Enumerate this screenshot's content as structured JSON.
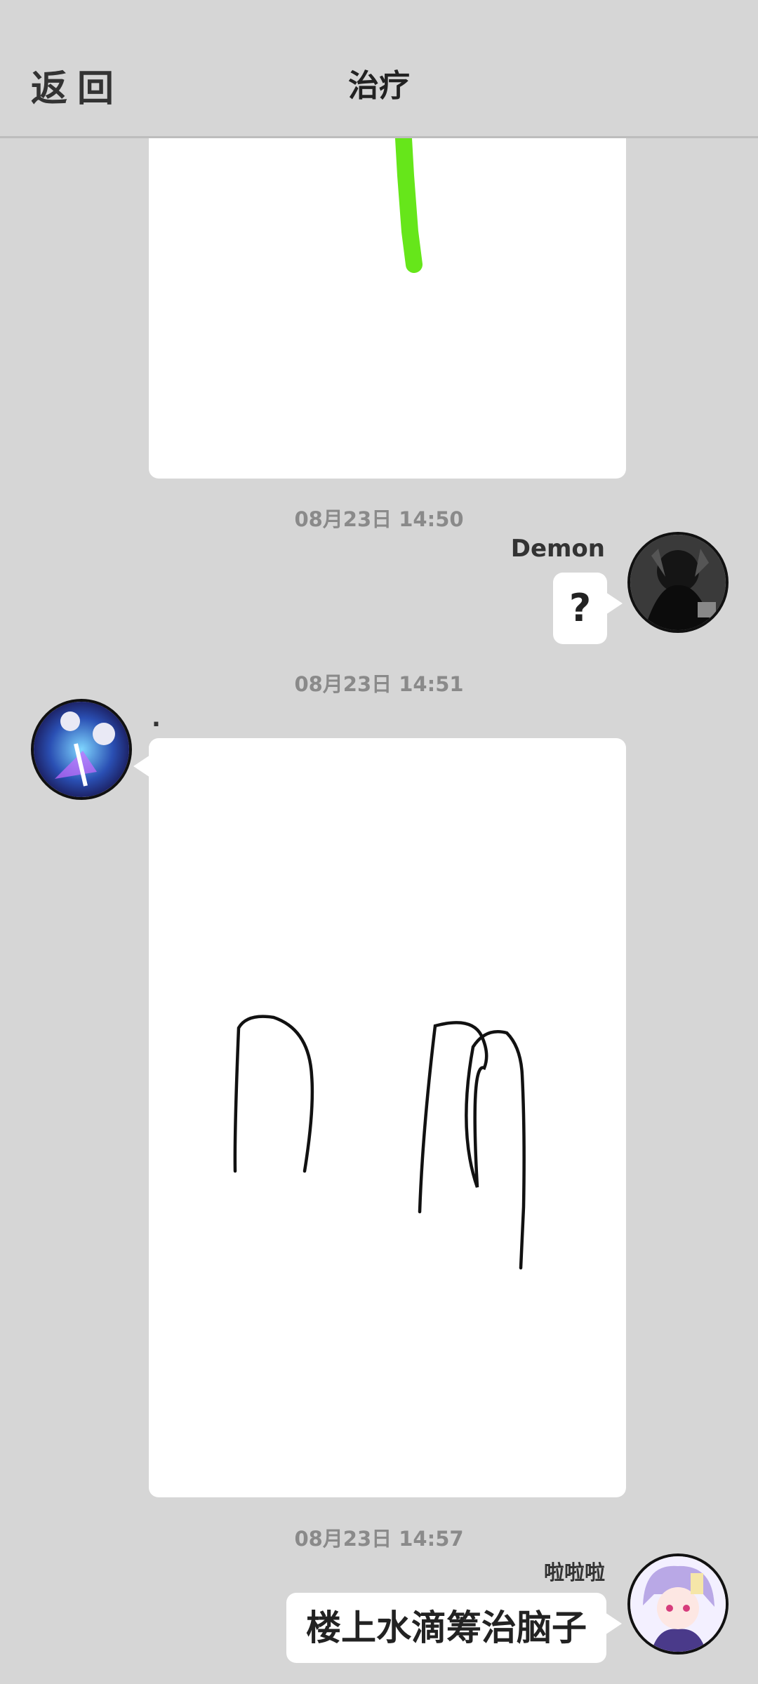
{
  "header": {
    "back_label": "返回",
    "title": "治疗"
  },
  "messages": {
    "msg1": {
      "type": "drawing"
    },
    "time2": "08月23日  14:50",
    "msg2": {
      "sender": "Demon",
      "text": "?"
    },
    "time3": "08月23日  14:51",
    "msg3": {
      "sender": ".",
      "type": "drawing"
    },
    "time4": "08月23日  14:57",
    "msg4": {
      "sender": "啦啦啦",
      "text": "楼上水滴筹治脑子"
    }
  },
  "colors": {
    "background": "#d6d6d6",
    "bubble": "#ffffff",
    "green_stroke": "#66e61a",
    "ink_stroke": "#111111"
  },
  "icons": {
    "avatar1": "dark-anime-avatar-icon",
    "avatar2": "blue-skeleton-avatar-icon",
    "avatar3": "anime-girl-avatar-icon"
  }
}
